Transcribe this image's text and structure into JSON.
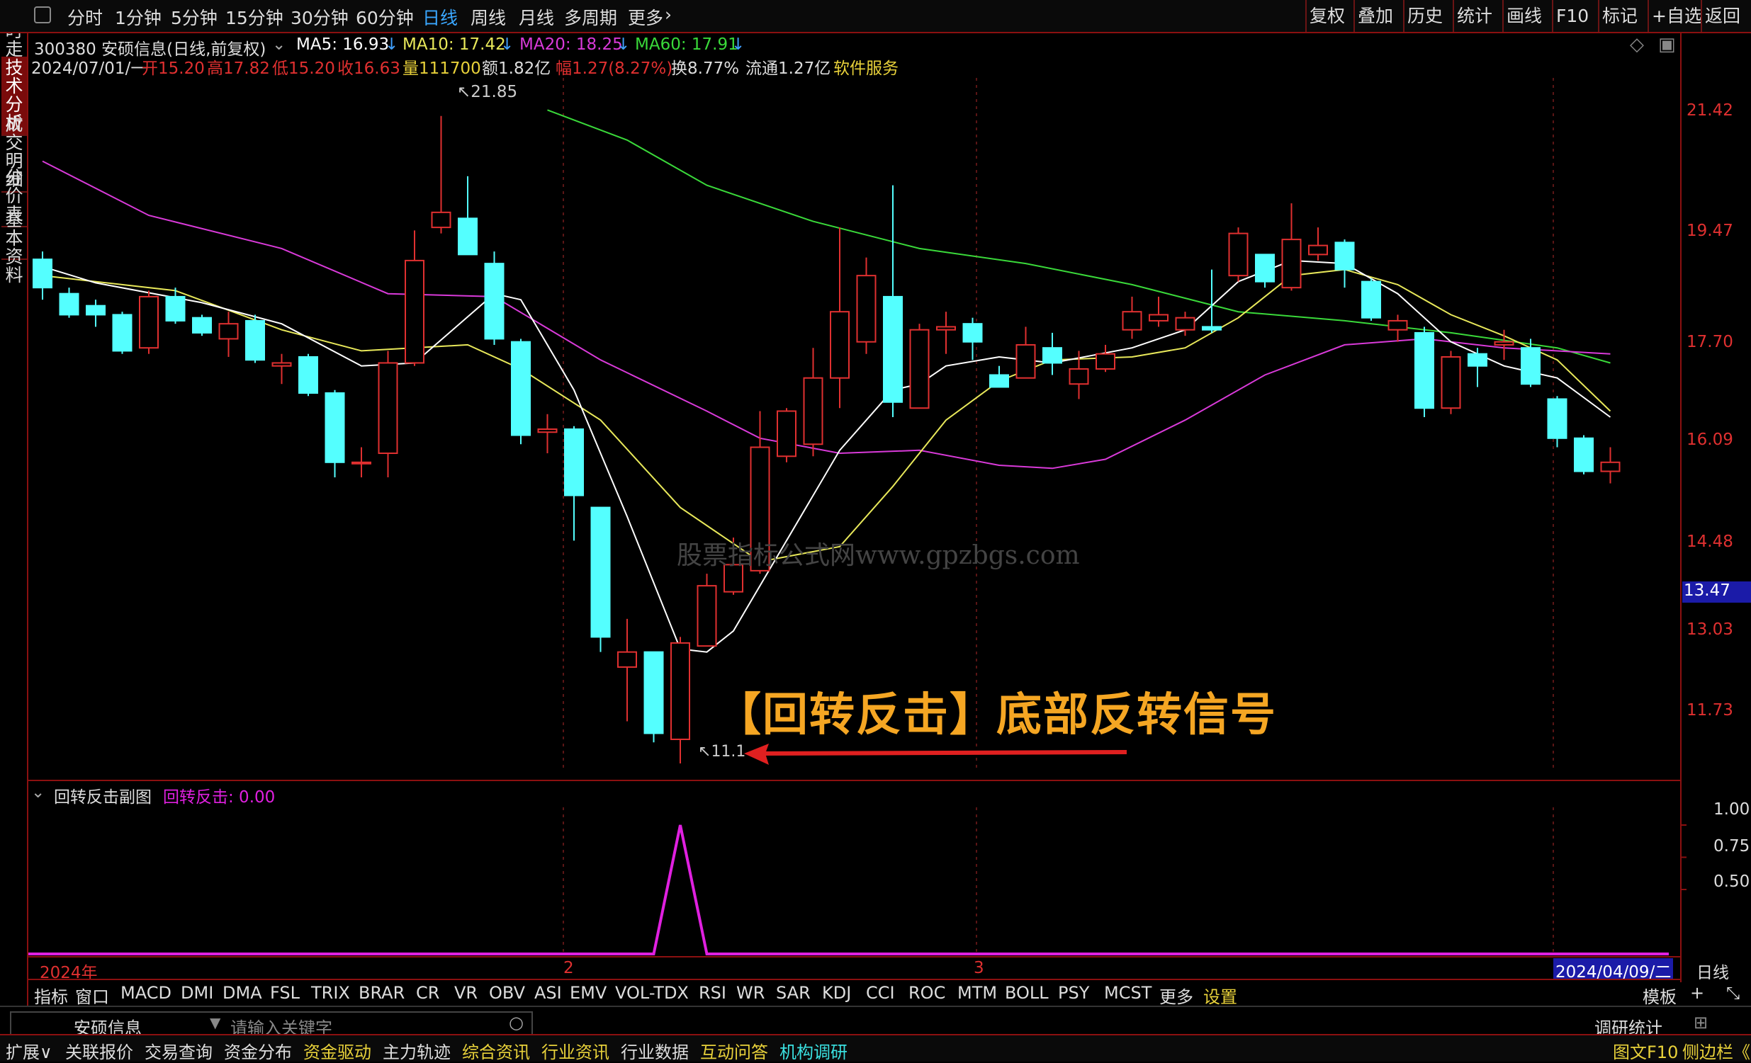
{
  "toolbar": {
    "periods": [
      "分时",
      "1分钟",
      "5分钟",
      "15分钟",
      "30分钟",
      "60分钟",
      "日线",
      "周线",
      "月线",
      "多周期",
      "更多"
    ],
    "right": [
      "复权",
      "叠加",
      "历史",
      "统计",
      "画线",
      "F10",
      "标记",
      "+自选",
      "返回"
    ]
  },
  "left_tabs": [
    "分时走势",
    "技术分析",
    "成交明细",
    "分价表",
    "基本资料"
  ],
  "stock": {
    "title": "300380 安硕信息(日线,前复权)",
    "ma5": "MA5: 16.93",
    "ma10": "MA10: 17.42",
    "ma20": "MA20: 18.25",
    "ma60": "MA60: 17.91"
  },
  "bar": {
    "date": "2024/07/01/一",
    "open": "开15.20",
    "high": "高17.82",
    "low": "低15.20",
    "close": "收16.63",
    "vol": "量111700",
    "amt": "额1.82亿",
    "chg": "幅1.27(8.27%)",
    "turn": "换8.77%",
    "float": "流通1.27亿",
    "industry": "软件服务"
  },
  "price_axis": [
    "21.42",
    "19.47",
    "17.70",
    "16.09",
    "14.48",
    "13.03",
    "11.73"
  ],
  "current_price": "13.47",
  "high_mark": "21.85",
  "low_mark": "11.1",
  "annotation": "【回转反击】底部反转信号",
  "watermark": "股票指标公式网www.gpzbgs.com",
  "indicator": {
    "name": "回转反击副图",
    "value": "回转反击: 0.00",
    "axis": [
      "1.00",
      "0.75",
      "0.50"
    ]
  },
  "date_axis": {
    "year": "2024年",
    "m2": "2",
    "m3": "3",
    "cursor": "2024/04/09/二",
    "period": "日线"
  },
  "ind_tabs": [
    "指标",
    "窗口",
    "MACD",
    "DMI",
    "DMA",
    "FSL",
    "TRIX",
    "BRAR",
    "CR",
    "VR",
    "OBV",
    "ASI",
    "EMV",
    "VOL-TDX",
    "RSI",
    "WR",
    "SAR",
    "KDJ",
    "CCI",
    "ROC",
    "MTM",
    "BOLL",
    "PSY",
    "MCST",
    "更多",
    "设置"
  ],
  "ind_right": {
    "tpl": "模板",
    "plus": "+",
    "expand": "⤡"
  },
  "search": {
    "stock": "安硕信息",
    "placeholder": "请输入关键字",
    "stats": "调研统计"
  },
  "bottom_tabs": [
    "扩展∨",
    "关联报价",
    "交易查询",
    "资金分布",
    "资金驱动",
    "主力轨迹",
    "综合资讯",
    "行业资讯",
    "行业数据",
    "互动问答",
    "机构调研"
  ],
  "bottom_right": [
    "图文F10",
    "侧边栏《"
  ],
  "colors": {
    "up": "#e03030",
    "down": "#54ffff",
    "ma5": "#ffffff",
    "ma10": "#e8e85a",
    "ma20": "#d93ad9",
    "ma60": "#3ad93a",
    "signal": "#e020e0"
  },
  "chart_data": {
    "type": "candlestick",
    "price_range": [
      10.9,
      22.6
    ],
    "candles": [
      {
        "o": 19.47,
        "c": 19.0,
        "h": 19.6,
        "l": 18.8
      },
      {
        "o": 18.9,
        "c": 18.55,
        "h": 19.0,
        "l": 18.5
      },
      {
        "o": 18.7,
        "c": 18.55,
        "h": 18.8,
        "l": 18.35
      },
      {
        "o": 18.55,
        "c": 17.95,
        "h": 18.6,
        "l": 17.9
      },
      {
        "o": 18.0,
        "c": 18.85,
        "h": 18.95,
        "l": 17.9
      },
      {
        "o": 18.85,
        "c": 18.45,
        "h": 19.0,
        "l": 18.4
      },
      {
        "o": 18.5,
        "c": 18.25,
        "h": 18.55,
        "l": 18.2
      },
      {
        "o": 18.15,
        "c": 18.4,
        "h": 18.6,
        "l": 17.85
      },
      {
        "o": 18.45,
        "c": 17.8,
        "h": 18.55,
        "l": 17.75
      },
      {
        "o": 17.7,
        "c": 17.75,
        "h": 17.9,
        "l": 17.4
      },
      {
        "o": 17.85,
        "c": 17.25,
        "h": 17.9,
        "l": 17.2
      },
      {
        "o": 17.25,
        "c": 16.1,
        "h": 17.3,
        "l": 15.85
      },
      {
        "o": 16.1,
        "c": 16.1,
        "h": 16.35,
        "l": 15.85
      },
      {
        "o": 16.25,
        "c": 17.75,
        "h": 17.95,
        "l": 15.85
      },
      {
        "o": 17.75,
        "c": 19.45,
        "h": 19.95,
        "l": 17.7
      },
      {
        "o": 20.0,
        "c": 20.25,
        "h": 21.85,
        "l": 19.9
      },
      {
        "o": 20.15,
        "c": 19.55,
        "h": 20.85,
        "l": 19.55
      },
      {
        "o": 19.4,
        "c": 18.15,
        "h": 19.6,
        "l": 18.05
      },
      {
        "o": 18.1,
        "c": 16.55,
        "h": 18.15,
        "l": 16.4
      },
      {
        "o": 16.6,
        "c": 16.65,
        "h": 16.9,
        "l": 16.25
      },
      {
        "o": 16.65,
        "c": 15.55,
        "h": 16.7,
        "l": 14.8
      },
      {
        "o": 15.35,
        "c": 13.2,
        "h": 15.35,
        "l": 12.95
      },
      {
        "o": 12.7,
        "c": 12.95,
        "h": 13.5,
        "l": 11.8
      },
      {
        "o": 12.95,
        "c": 11.6,
        "h": 12.95,
        "l": 11.45
      },
      {
        "o": 11.5,
        "c": 13.1,
        "h": 13.2,
        "l": 11.1
      },
      {
        "o": 13.05,
        "c": 14.05,
        "h": 14.25,
        "l": 13.05
      },
      {
        "o": 13.95,
        "c": 14.4,
        "h": 14.85,
        "l": 13.9
      },
      {
        "o": 14.3,
        "c": 16.35,
        "h": 16.95,
        "l": 14.25
      },
      {
        "o": 16.2,
        "c": 16.95,
        "h": 17.0,
        "l": 16.1
      },
      {
        "o": 16.4,
        "c": 17.5,
        "h": 18.0,
        "l": 16.2
      },
      {
        "o": 17.5,
        "c": 18.6,
        "h": 20.0,
        "l": 17.0
      },
      {
        "o": 18.1,
        "c": 19.2,
        "h": 19.5,
        "l": 17.9
      },
      {
        "o": 18.85,
        "c": 17.1,
        "h": 20.7,
        "l": 16.85
      },
      {
        "o": 17.0,
        "c": 18.3,
        "h": 18.4,
        "l": 17.0
      },
      {
        "o": 18.3,
        "c": 18.35,
        "h": 18.6,
        "l": 17.9
      },
      {
        "o": 18.4,
        "c": 18.1,
        "h": 18.5,
        "l": 17.8
      },
      {
        "o": 17.55,
        "c": 17.35,
        "h": 17.7,
        "l": 17.35
      },
      {
        "o": 17.5,
        "c": 18.05,
        "h": 18.35,
        "l": 17.5
      },
      {
        "o": 18.0,
        "c": 17.75,
        "h": 18.25,
        "l": 17.55
      },
      {
        "o": 17.4,
        "c": 17.65,
        "h": 17.95,
        "l": 17.15
      },
      {
        "o": 17.65,
        "c": 17.9,
        "h": 18.05,
        "l": 17.6
      },
      {
        "o": 18.3,
        "c": 18.6,
        "h": 18.85,
        "l": 18.15
      },
      {
        "o": 18.45,
        "c": 18.55,
        "h": 18.85,
        "l": 18.35
      },
      {
        "o": 18.3,
        "c": 18.5,
        "h": 18.6,
        "l": 18.2
      },
      {
        "o": 18.35,
        "c": 18.3,
        "h": 19.3,
        "l": 18.25
      },
      {
        "o": 19.2,
        "c": 19.9,
        "h": 20.0,
        "l": 19.1
      },
      {
        "o": 19.55,
        "c": 19.1,
        "h": 19.55,
        "l": 19.0
      },
      {
        "o": 19.0,
        "c": 19.8,
        "h": 20.4,
        "l": 18.95
      },
      {
        "o": 19.55,
        "c": 19.7,
        "h": 20.0,
        "l": 19.45
      },
      {
        "o": 19.75,
        "c": 19.3,
        "h": 19.8,
        "l": 19.0
      },
      {
        "o": 19.1,
        "c": 18.5,
        "h": 19.15,
        "l": 18.45
      },
      {
        "o": 18.3,
        "c": 18.45,
        "h": 18.55,
        "l": 18.1
      },
      {
        "o": 18.25,
        "c": 17.0,
        "h": 18.35,
        "l": 16.85
      },
      {
        "o": 17.0,
        "c": 17.85,
        "h": 17.95,
        "l": 16.9
      },
      {
        "o": 17.9,
        "c": 17.7,
        "h": 18.0,
        "l": 17.35
      },
      {
        "o": 18.05,
        "c": 18.1,
        "h": 18.3,
        "l": 17.8
      },
      {
        "o": 18.0,
        "c": 17.4,
        "h": 18.15,
        "l": 17.35
      },
      {
        "o": 17.15,
        "c": 16.5,
        "h": 17.2,
        "l": 16.35
      },
      {
        "o": 16.5,
        "c": 15.95,
        "h": 16.55,
        "l": 15.9
      },
      {
        "o": 15.95,
        "c": 16.1,
        "h": 16.35,
        "l": 15.75
      }
    ],
    "ma5": [
      [
        0,
        19.35
      ],
      [
        2,
        19.08
      ],
      [
        6,
        18.75
      ],
      [
        9,
        18.4
      ],
      [
        12,
        17.7
      ],
      [
        14,
        17.75
      ],
      [
        17,
        18.9
      ],
      [
        18,
        18.8
      ],
      [
        20,
        17.3
      ],
      [
        22,
        15.2
      ],
      [
        24,
        13.0
      ],
      [
        25,
        12.95
      ],
      [
        26,
        13.3
      ],
      [
        28,
        14.8
      ],
      [
        30,
        16.3
      ],
      [
        32,
        17.3
      ],
      [
        33,
        17.4
      ],
      [
        34,
        17.7
      ],
      [
        36,
        17.85
      ],
      [
        38,
        17.75
      ],
      [
        41,
        18.0
      ],
      [
        43,
        18.3
      ],
      [
        45,
        19.1
      ],
      [
        47,
        19.45
      ],
      [
        49,
        19.4
      ],
      [
        51,
        18.9
      ],
      [
        53,
        18.1
      ],
      [
        55,
        17.7
      ],
      [
        57,
        17.5
      ],
      [
        59,
        16.85
      ]
    ],
    "ma10": [
      [
        0,
        19.2
      ],
      [
        5,
        18.95
      ],
      [
        9,
        18.3
      ],
      [
        12,
        17.95
      ],
      [
        16,
        18.05
      ],
      [
        18,
        17.65
      ],
      [
        21,
        16.8
      ],
      [
        24,
        15.35
      ],
      [
        27,
        14.45
      ],
      [
        30,
        14.7
      ],
      [
        32,
        15.7
      ],
      [
        34,
        16.8
      ],
      [
        36,
        17.45
      ],
      [
        38,
        17.8
      ],
      [
        41,
        17.85
      ],
      [
        43,
        18.0
      ],
      [
        45,
        18.5
      ],
      [
        47,
        19.2
      ],
      [
        49,
        19.3
      ],
      [
        51,
        19.05
      ],
      [
        53,
        18.55
      ],
      [
        55,
        18.2
      ],
      [
        57,
        17.8
      ],
      [
        59,
        16.95
      ]
    ],
    "ma20": [
      [
        0,
        21.1
      ],
      [
        4,
        20.2
      ],
      [
        9,
        19.65
      ],
      [
        13,
        18.9
      ],
      [
        17,
        18.85
      ],
      [
        21,
        17.8
      ],
      [
        25,
        16.95
      ],
      [
        27,
        16.5
      ],
      [
        30,
        16.25
      ],
      [
        33,
        16.3
      ],
      [
        36,
        16.05
      ],
      [
        38,
        16.0
      ],
      [
        40,
        16.15
      ],
      [
        43,
        16.8
      ],
      [
        46,
        17.55
      ],
      [
        49,
        18.05
      ],
      [
        52,
        18.15
      ],
      [
        55,
        18.0
      ],
      [
        59,
        17.9
      ]
    ],
    "ma60": [
      [
        19,
        21.95
      ],
      [
        22,
        21.45
      ],
      [
        25,
        20.7
      ],
      [
        29,
        20.1
      ],
      [
        33,
        19.65
      ],
      [
        37,
        19.4
      ],
      [
        41,
        19.05
      ],
      [
        45,
        18.6
      ],
      [
        49,
        18.45
      ],
      [
        53,
        18.25
      ],
      [
        57,
        18.0
      ],
      [
        59,
        17.75
      ]
    ],
    "signal": {
      "range": [
        0,
        1
      ],
      "axis_ticks": [
        0.5,
        0.75,
        1
      ],
      "peak_index": 24,
      "peak_value": 1
    }
  }
}
